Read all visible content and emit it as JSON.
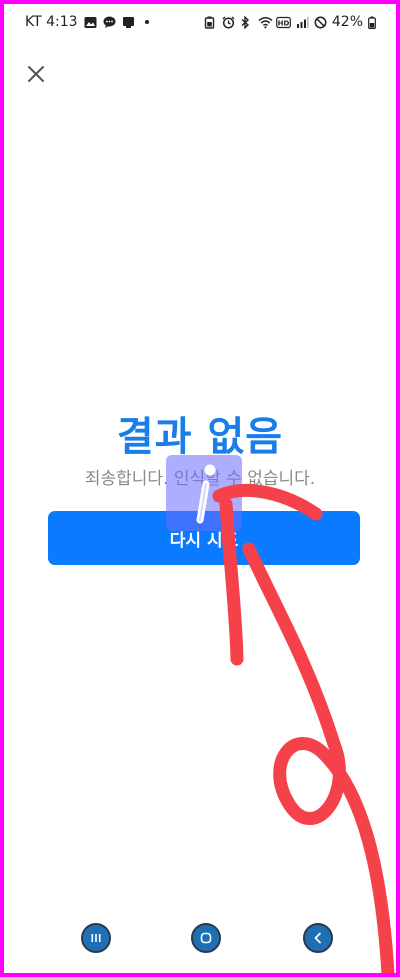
{
  "status_bar": {
    "carrier_time": "KT 4:13",
    "battery": "42%",
    "icons_left": [
      "image-icon",
      "chat-icon",
      "app-icon"
    ],
    "icons_right": [
      "battery-saver-icon",
      "alarm-icon",
      "bluetooth-icon",
      "wifi-icon",
      "hd-icon",
      "signal-icon",
      "dnd-icon",
      "battery-icon"
    ]
  },
  "main": {
    "title": "결과 없음",
    "subtitle": "죄송합니다. 인식할 수 없습니다.",
    "retry_label": "다시 시도"
  },
  "nav_bar": {
    "recents_icon": "recents-icon",
    "home_icon": "home-icon",
    "back_icon": "back-icon"
  },
  "colors": {
    "accent": "#1a7ee8",
    "button": "#0a7aff",
    "annotation_red": "#f5424a",
    "annotation_overlay": "#6b6bff",
    "frame": "#ff00ff"
  }
}
